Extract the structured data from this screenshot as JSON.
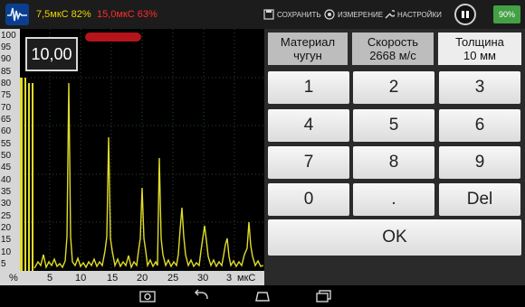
{
  "statusbar": {
    "gate1": "7,5мкС 82%",
    "gate2": "15,0мкС 63%",
    "save_label": "СОХРАНИТЬ",
    "measure_label": "ИЗМЕРЕНИЕ",
    "settings_label": "НАСТРОЙКИ",
    "battery": "90%"
  },
  "plot": {
    "readout": "10,00",
    "y_ticks": [
      "100",
      "95",
      "90",
      "85",
      "80",
      "75",
      "70",
      "65",
      "60",
      "55",
      "50",
      "45",
      "40",
      "35",
      "30",
      "25",
      "20",
      "15",
      "10",
      "5"
    ],
    "x_ticks": [
      "%",
      "5",
      "10",
      "15",
      "20",
      "25",
      "30",
      "3",
      "мкС"
    ]
  },
  "tabs": [
    {
      "line1": "Материал",
      "line2": "чугун"
    },
    {
      "line1": "Скорость",
      "line2": "2668 м/с"
    },
    {
      "line1": "Толщина",
      "line2": "10 мм"
    }
  ],
  "keypad": {
    "keys": [
      "1",
      "2",
      "3",
      "4",
      "5",
      "6",
      "7",
      "8",
      "9",
      "0",
      ".",
      "Del"
    ],
    "ok": "OK"
  },
  "colors": {
    "signal": "#e0dc2a",
    "gate": "#b3151b",
    "accent": "#e8d400"
  }
}
